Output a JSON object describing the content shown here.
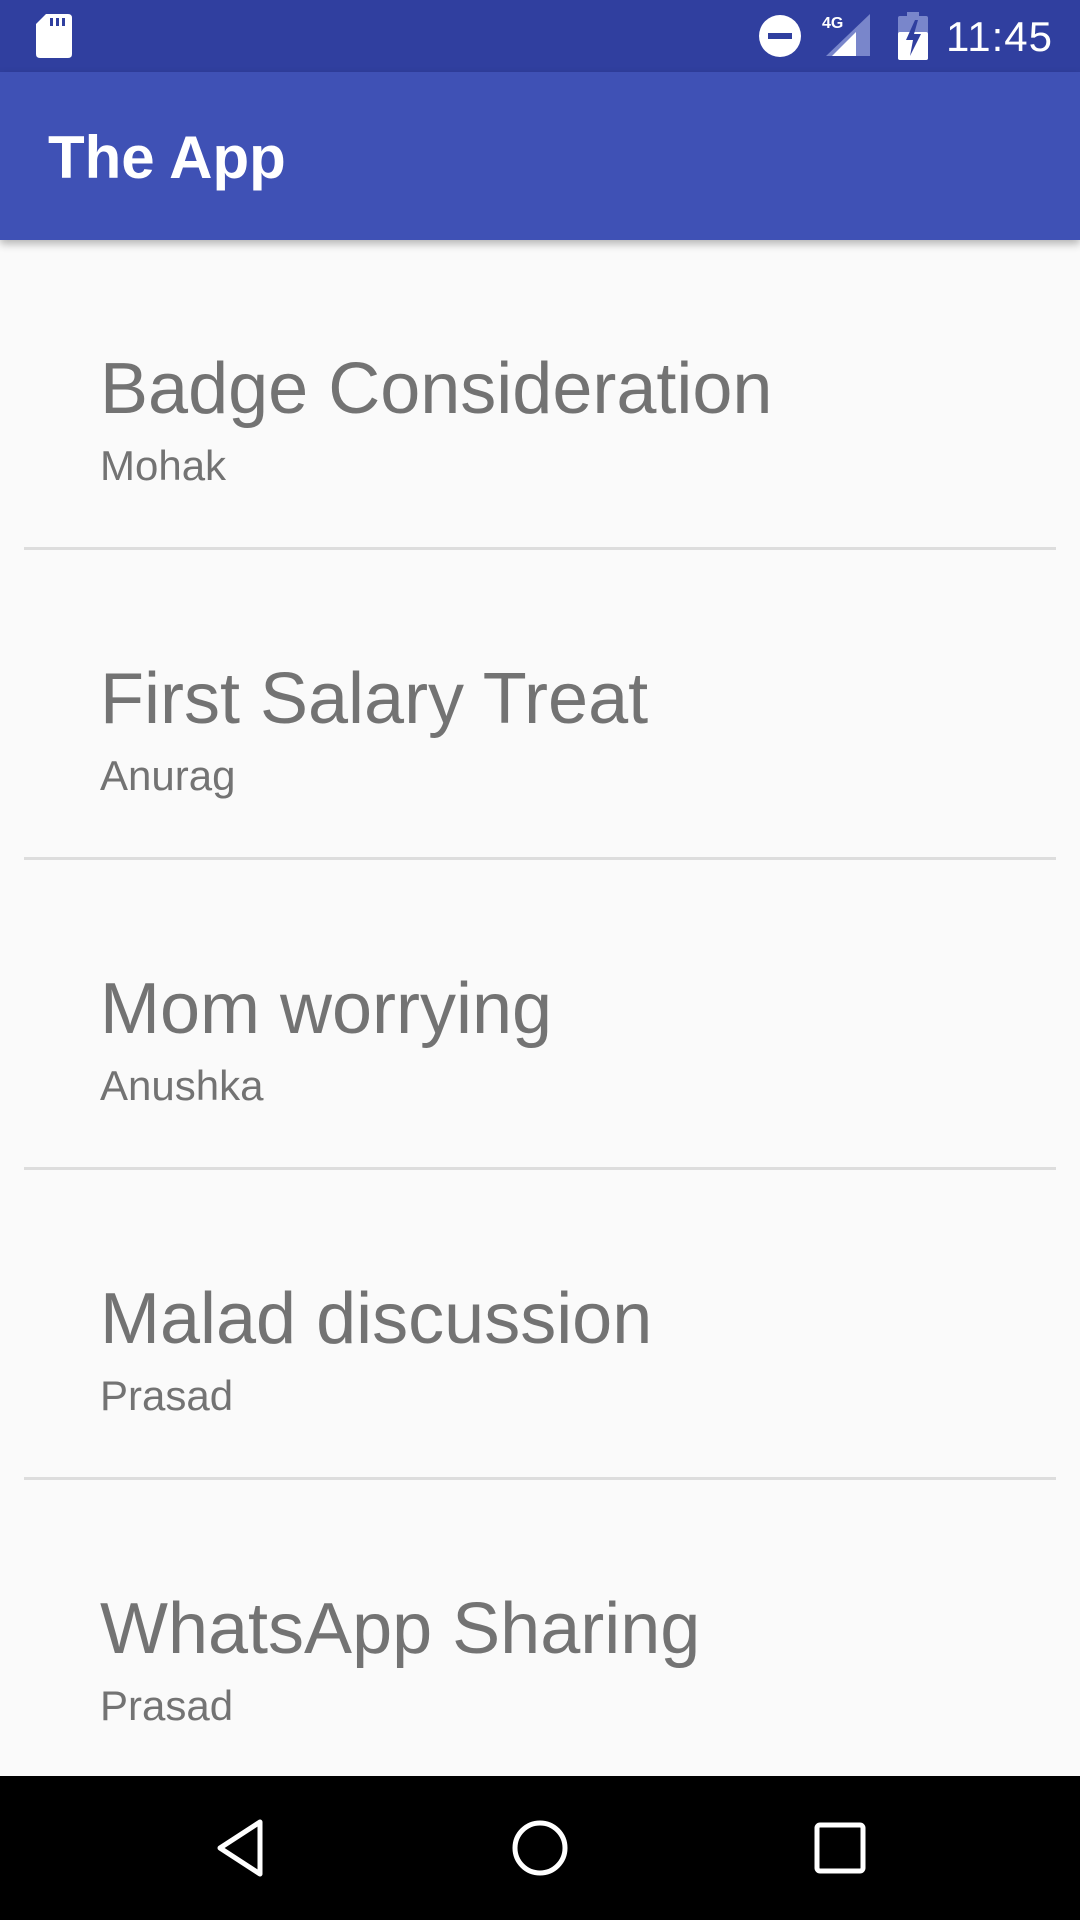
{
  "status_bar": {
    "time": "11:45",
    "network": "4G",
    "icons": [
      "sd-card-icon",
      "do-not-disturb-icon",
      "cell-signal-icon",
      "battery-charging-icon"
    ],
    "background_color": "#303f9f"
  },
  "app_bar": {
    "title": "The App",
    "background_color": "#3f51b5"
  },
  "list": {
    "items": [
      {
        "title": "Badge Consideration",
        "subtitle": "Mohak"
      },
      {
        "title": "First Salary Treat",
        "subtitle": "Anurag"
      },
      {
        "title": "Mom worrying",
        "subtitle": "Anushka"
      },
      {
        "title": "Malad discussion",
        "subtitle": "Prasad"
      },
      {
        "title": "WhatsApp Sharing",
        "subtitle": "Prasad"
      }
    ]
  },
  "nav_bar": {
    "icons": [
      "back-icon",
      "home-icon",
      "recents-icon"
    ]
  }
}
